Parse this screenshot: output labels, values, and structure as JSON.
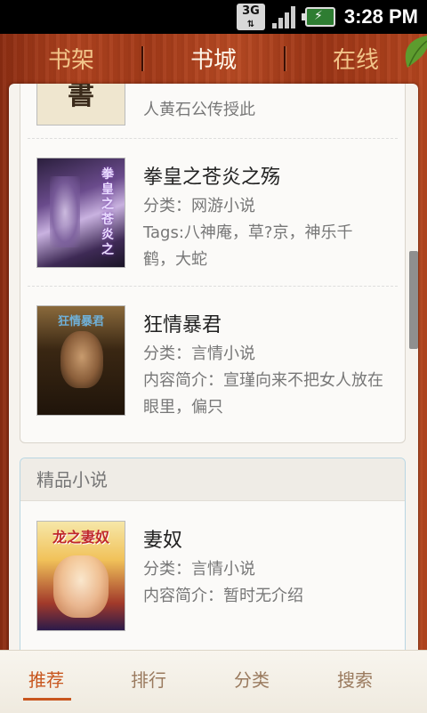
{
  "status_bar": {
    "network": "3G",
    "time": "3:28 PM",
    "signal_icon": "signal-bars-icon",
    "battery_icon": "battery-charging-icon"
  },
  "top_tabs": [
    {
      "label": "书架",
      "active": false
    },
    {
      "label": "书城",
      "active": true
    },
    {
      "label": "在线",
      "active": false
    }
  ],
  "recommended_books": [
    {
      "title": "",
      "category": "",
      "description": "人黄石公传授此",
      "cover_text": "書"
    },
    {
      "title": "拳皇之苍炎之殇",
      "category": "分类：网游小说",
      "description": "Tags:八神庵，草?京，神乐千鹤，大蛇"
    },
    {
      "title": "狂情暴君",
      "category": "分类：言情小说",
      "description": "内容简介：宣瑾向来不把女人放在眼里，偏只"
    }
  ],
  "featured_section": {
    "title": "精品小说",
    "books": [
      {
        "title": "妻奴",
        "category": "分类：言情小说",
        "description": "内容简介：暂时无介绍",
        "cover_text": "龙之妻奴"
      }
    ]
  },
  "bottom_nav": [
    {
      "label": "推荐",
      "active": true
    },
    {
      "label": "排行",
      "active": false
    },
    {
      "label": "分类",
      "active": false
    },
    {
      "label": "搜索",
      "active": false
    }
  ],
  "colors": {
    "wood": "#a33a19",
    "active_tab": "#fff7ea",
    "inactive_tab": "#f2c58a",
    "nav_active": "#c8561e"
  }
}
